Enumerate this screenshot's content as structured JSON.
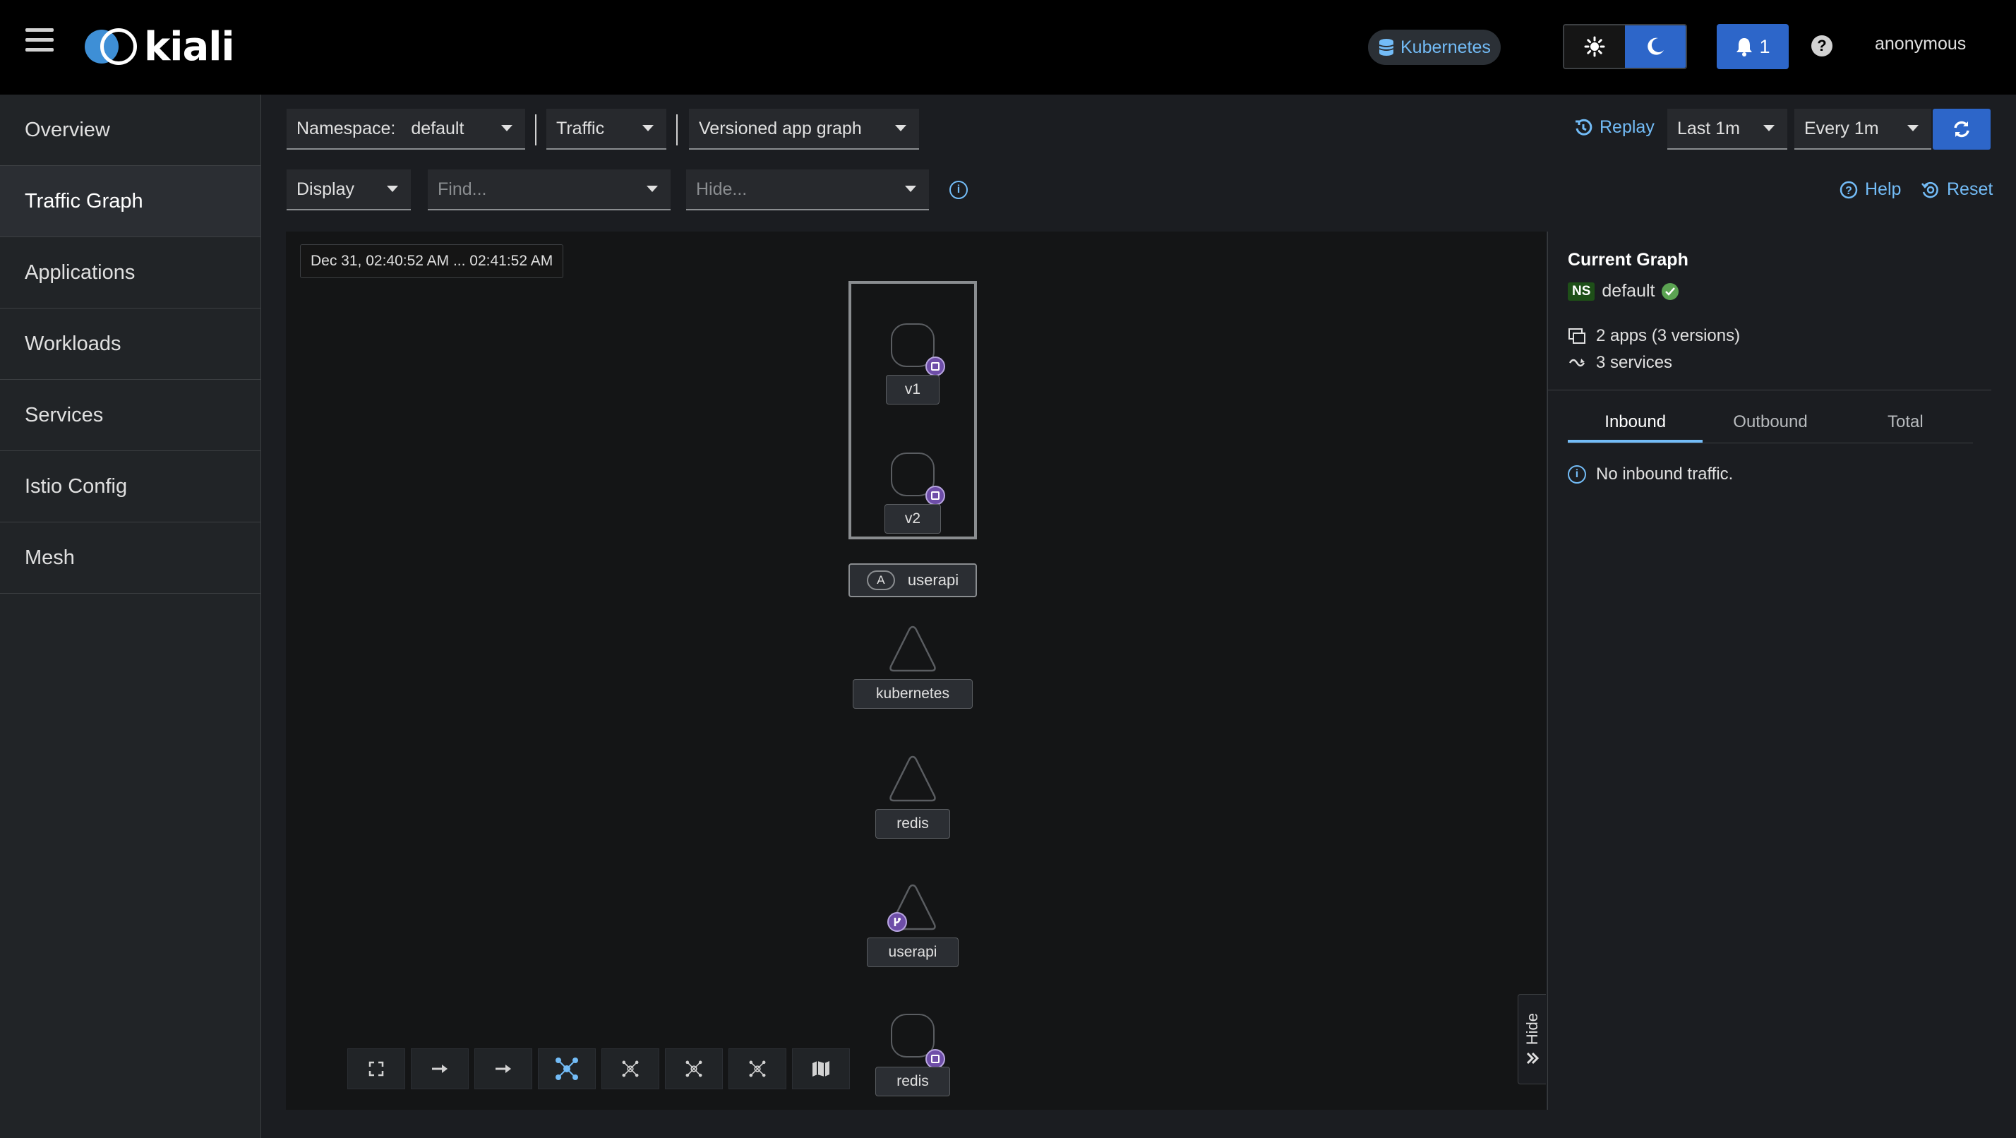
{
  "header": {
    "logo_text": "kiali",
    "cluster": "Kubernetes",
    "notifications_count": "1",
    "user": "anonymous"
  },
  "sidebar": {
    "items": [
      {
        "label": "Overview",
        "active": false
      },
      {
        "label": "Traffic Graph",
        "active": true
      },
      {
        "label": "Applications",
        "active": false
      },
      {
        "label": "Workloads",
        "active": false
      },
      {
        "label": "Services",
        "active": false
      },
      {
        "label": "Istio Config",
        "active": false
      },
      {
        "label": "Mesh",
        "active": false
      }
    ]
  },
  "toolbar": {
    "namespace_label": "Namespace:",
    "namespace_value": "default",
    "traffic_label": "Traffic",
    "graph_type": "Versioned app graph",
    "display_label": "Display",
    "find_placeholder": "Find...",
    "hide_placeholder": "Hide...",
    "replay_label": "Replay",
    "duration": "Last 1m",
    "refresh_interval": "Every 1m",
    "help_label": "Help",
    "reset_label": "Reset"
  },
  "graph": {
    "time_range": "Dec 31, 02:40:52 AM ... 02:41:52 AM",
    "app_box": {
      "badge": "A",
      "name": "userapi"
    },
    "nodes": {
      "v1": "v1",
      "v2": "v2",
      "kubernetes": "kubernetes",
      "redis_service": "redis",
      "userapi_service": "userapi",
      "redis_workload": "redis"
    },
    "hide_label": "Hide"
  },
  "panel": {
    "title": "Current Graph",
    "ns_badge": "NS",
    "namespace": "default",
    "apps": "2 apps (3 versions)",
    "services": "3 services",
    "tabs": [
      "Inbound",
      "Outbound",
      "Total"
    ],
    "active_tab": "Inbound",
    "message": "No inbound traffic."
  },
  "colors": {
    "accent": "#2d66c9",
    "link": "#73bcf7",
    "sidecar_badge": "#6e4ea8",
    "healthy": "#5ba352"
  }
}
